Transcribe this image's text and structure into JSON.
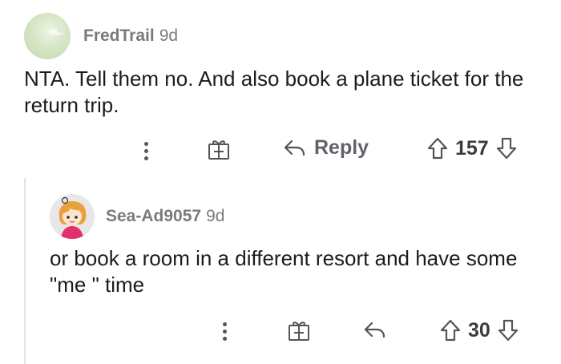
{
  "comments": [
    {
      "username": "FredTrail",
      "age": "9d",
      "body": "NTA. Tell them no. And also book a plane ticket for the return trip.",
      "actions": {
        "reply_label": "Reply",
        "vote_count": "157"
      },
      "icons": [
        "more-options-icon",
        "award-icon",
        "reply-icon",
        "upvote-icon",
        "downvote-icon"
      ]
    },
    {
      "username": "Sea-Ad9057",
      "age": "9d",
      "body": "or book a room in a different resort and have some \"me \" time",
      "actions": {
        "vote_count": "30"
      },
      "icons": [
        "more-options-icon",
        "award-icon",
        "reply-icon",
        "upvote-icon",
        "downvote-icon"
      ]
    }
  ],
  "colors": {
    "meta_text": "#787c7e",
    "body_text": "#1c1c1c",
    "thread_line": "#e3e3e3",
    "icon": "#555555"
  }
}
